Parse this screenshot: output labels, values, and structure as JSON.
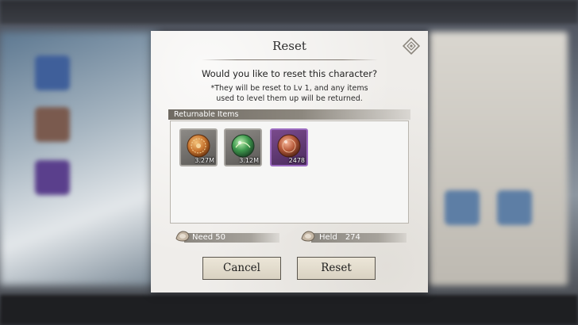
{
  "dialog": {
    "title": "Reset",
    "question": "Would you like to reset this character?",
    "note_line1": "*They will be reset to Lv 1, and any items",
    "note_line2": "used to level them up will be returned.",
    "items_header": "Returnable Items",
    "items": [
      {
        "count": "3.27M",
        "icon": "gold-coin-icon",
        "rarity_color": "#a9a6a1"
      },
      {
        "count": "3.12M",
        "icon": "green-orb-icon",
        "rarity_color": "#a9a6a1"
      },
      {
        "count": "2478",
        "icon": "copper-orb-icon",
        "rarity_color": "#9c6cc0"
      }
    ],
    "need_label": "Need 50",
    "held_label": "Held",
    "held_value": "274",
    "cancel_label": "Cancel",
    "reset_label": "Reset"
  }
}
